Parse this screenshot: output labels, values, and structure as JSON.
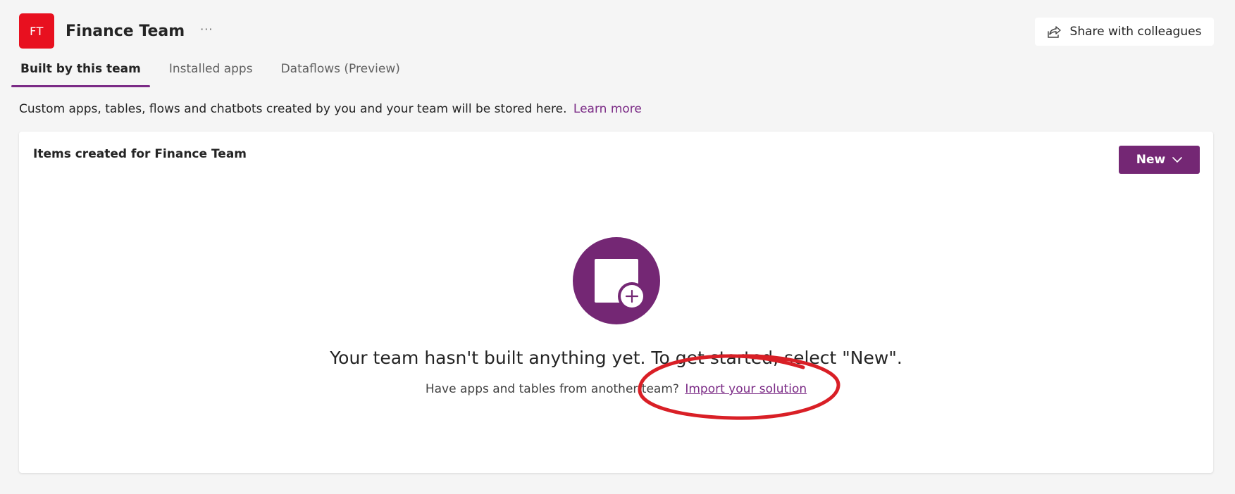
{
  "header": {
    "avatar_initials": "FT",
    "team_name": "Finance Team",
    "more_label": "···",
    "share_label": "Share with colleagues",
    "avatar_color": "#e8101f"
  },
  "tabs": [
    {
      "label": "Built by this team",
      "active": true
    },
    {
      "label": "Installed apps",
      "active": false
    },
    {
      "label": "Dataflows (Preview)",
      "active": false
    }
  ],
  "description": {
    "text": "Custom apps, tables, flows and chatbots created by you and your team will be stored here.",
    "link": "Learn more"
  },
  "card": {
    "title": "Items created for Finance Team",
    "new_button_label": "New",
    "empty_icon": "add-item-icon",
    "empty_title": "Your team hasn't built anything yet. To get started, select \"New\".",
    "empty_sub_text": "Have apps and tables from another team?",
    "import_link": "Import your solution"
  },
  "colors": {
    "accent": "#742774",
    "link": "#7b2b86",
    "annotation": "#d91f26",
    "background": "#f5f5f5"
  }
}
